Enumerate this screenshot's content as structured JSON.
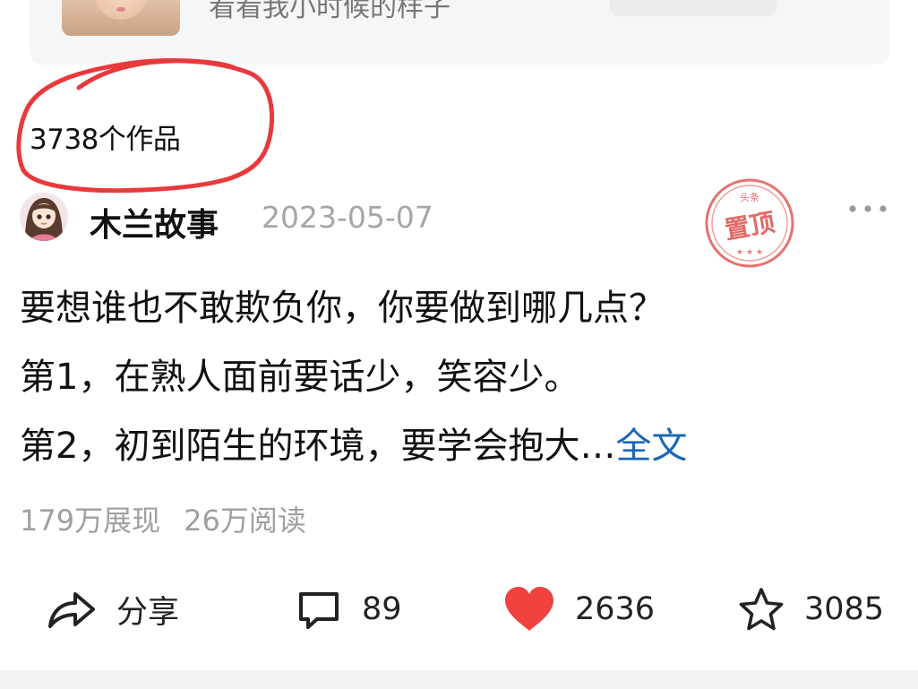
{
  "top_card": {
    "caption": "看看我小时候的样子"
  },
  "profile": {
    "works_count": "3738个作品"
  },
  "post": {
    "author": "木兰故事",
    "date": "2023-05-07",
    "pin_stamp": {
      "small_text": "头条",
      "main_text": "置顶",
      "color": "#e05a55"
    },
    "body_lines": [
      "要想谁也不敢欺负你，你要做到哪几点？",
      "第1，在熟人面前要话少，笑容少。",
      "第2，初到陌生的环境，要学会抱大…"
    ],
    "full_text_link": "全文",
    "impressions": "179万展现",
    "reads": "26万阅读"
  },
  "actions": {
    "share_label": "分享",
    "comments": "89",
    "likes": "2636",
    "favorites": "3085"
  },
  "colors": {
    "link": "#1a66b8",
    "like_heart": "#f0423f",
    "annotation_red": "#e8393d",
    "muted_text": "#a6a6a6"
  },
  "icons": [
    "share-icon",
    "comment-icon",
    "heart-icon",
    "star-icon",
    "more-icon"
  ]
}
